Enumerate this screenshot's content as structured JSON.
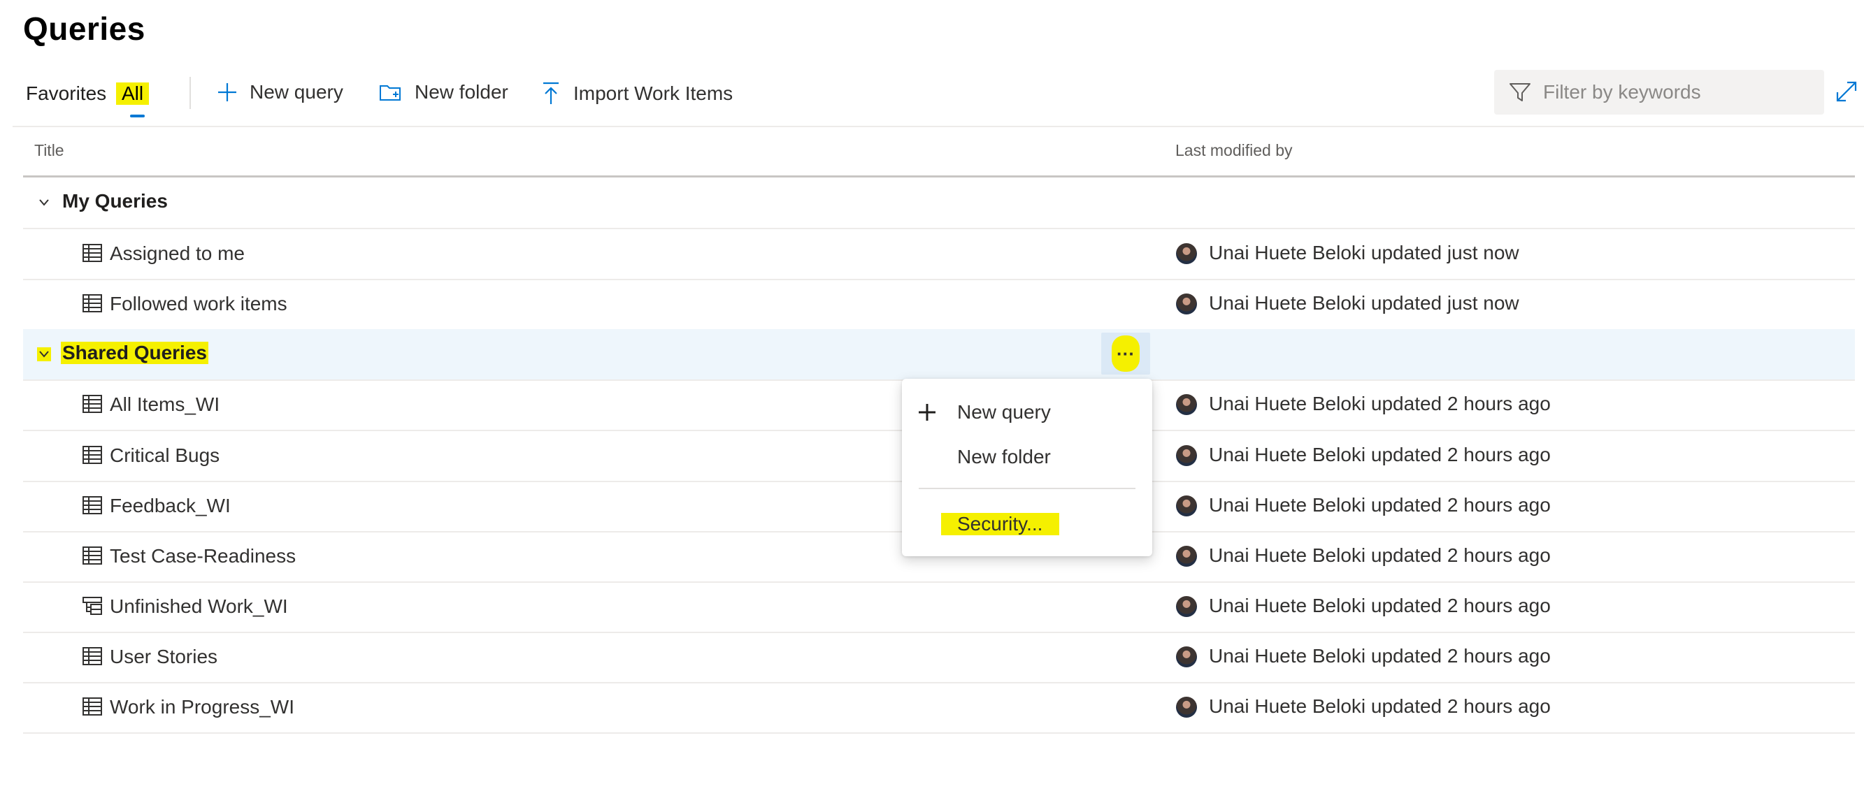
{
  "page": {
    "title": "Queries"
  },
  "tabs": [
    {
      "label": "Favorites",
      "selected": false
    },
    {
      "label": "All",
      "selected": true
    }
  ],
  "toolbar": {
    "new_query": "New query",
    "new_folder": "New folder",
    "import": "Import Work Items"
  },
  "filter": {
    "placeholder": "Filter by keywords"
  },
  "columns": {
    "title": "Title",
    "last_modified": "Last modified by"
  },
  "folders": [
    {
      "label": "My Queries",
      "expanded": true,
      "items": [
        {
          "label": "Assigned to me",
          "icon": "flat-list-query-icon",
          "modified": "Unai Huete Beloki updated just now"
        },
        {
          "label": "Followed work items",
          "icon": "flat-list-query-icon",
          "modified": "Unai Huete Beloki updated just now"
        }
      ]
    },
    {
      "label": "Shared Queries",
      "expanded": true,
      "selected": true,
      "items": [
        {
          "label": "All Items_WI",
          "icon": "flat-list-query-icon",
          "modified": "Unai Huete Beloki updated 2 hours ago"
        },
        {
          "label": "Critical Bugs",
          "icon": "flat-list-query-icon",
          "modified": "Unai Huete Beloki updated 2 hours ago"
        },
        {
          "label": "Feedback_WI",
          "icon": "flat-list-query-icon",
          "modified": "Unai Huete Beloki updated 2 hours ago"
        },
        {
          "label": "Test Case-Readiness",
          "icon": "flat-list-query-icon",
          "modified": "Unai Huete Beloki updated 2 hours ago"
        },
        {
          "label": "Unfinished Work_WI",
          "icon": "tree-query-icon",
          "modified": "Unai Huete Beloki updated 2 hours ago"
        },
        {
          "label": "User Stories",
          "icon": "flat-list-query-icon",
          "modified": "Unai Huete Beloki updated 2 hours ago"
        },
        {
          "label": "Work in Progress_WI",
          "icon": "flat-list-query-icon",
          "modified": "Unai Huete Beloki updated 2 hours ago"
        }
      ]
    }
  ],
  "more_button": {
    "label": "···",
    "icon": "more-actions-icon"
  },
  "context_menu": {
    "new_query": "New query",
    "new_folder": "New folder",
    "security": "Security..."
  },
  "colors": {
    "accent": "#0078d4",
    "highlight": "#f5f000",
    "selected_row": "#eef6fc"
  }
}
